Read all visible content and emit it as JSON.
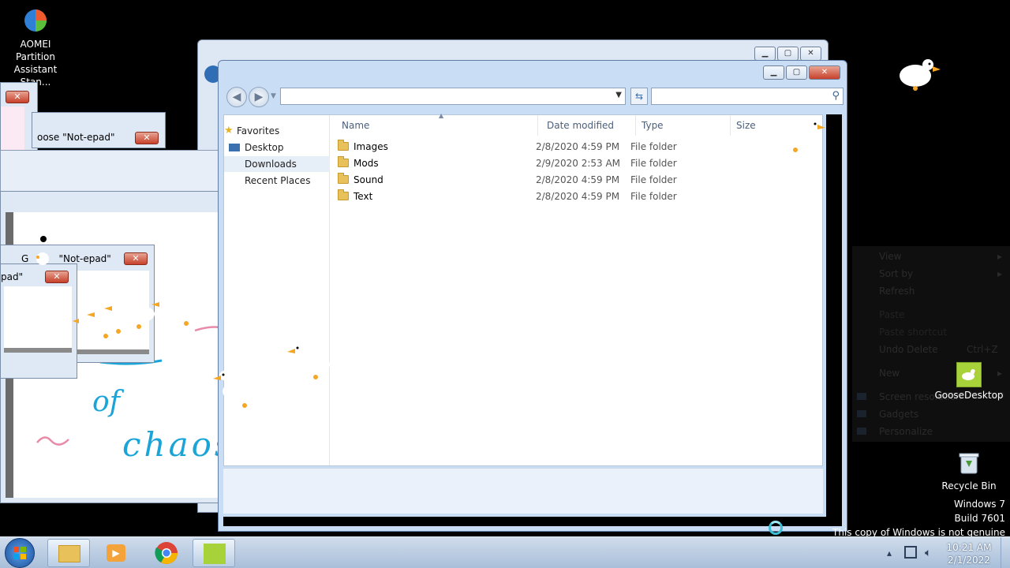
{
  "desktop": {
    "icons": {
      "aomei": {
        "line1": "AOMEI Partition",
        "line2": "Assistant Stan..."
      },
      "goose_desktop": "GooseDesktop",
      "recycle_bin": "Recycle Bin"
    },
    "watermark": {
      "line1": "Windows 7",
      "line2": "Build 7601",
      "line3": "This copy of Windows is not genuine"
    }
  },
  "background_windows": {
    "goose_dialog_1_title": "oose \"Not-epad\"",
    "goose_dialog_2_title": "G          \"Not-epad\"",
    "goose_dialog_3_title": "pad\"",
    "notepad_drawing_text": [
      "of",
      "chaos"
    ]
  },
  "explorer": {
    "address_value": "",
    "search_placeholder": "",
    "nav": [
      {
        "label": "Favorites"
      },
      {
        "label": "Desktop"
      },
      {
        "label": "Downloads"
      },
      {
        "label": "Recent Places"
      }
    ],
    "columns": {
      "name": "Name",
      "date": "Date modified",
      "type": "Type",
      "size": "Size"
    },
    "files": [
      {
        "name": "Images",
        "date": "2/8/2020 4:59 PM",
        "type": "File folder"
      },
      {
        "name": "Mods",
        "date": "2/9/2020 2:53 AM",
        "type": "File folder"
      },
      {
        "name": "Sound",
        "date": "2/8/2020 4:59 PM",
        "type": "File folder"
      },
      {
        "name": "Text",
        "date": "2/8/2020 4:59 PM",
        "type": "File folder"
      }
    ]
  },
  "context_menu": {
    "view": "View",
    "sort_by": "Sort by",
    "refresh": "Refresh",
    "paste": "Paste",
    "paste_shortcut": "Paste shortcut",
    "undo_delete": "Undo Delete",
    "undo_delete_accel": "Ctrl+Z",
    "new": "New",
    "screen_resolution": "Screen resolution",
    "gadgets": "Gadgets",
    "personalize": "Personalize"
  },
  "taskbar": {
    "time": "10:21 AM",
    "date": "2/1/2022"
  },
  "colors": {
    "accent_titlebar": "#c9def5",
    "close_button": "#c7412b",
    "goose_beak": "#f5a623",
    "drawing_blue": "#1aa4d8",
    "drawing_pink": "#e88aa8"
  }
}
